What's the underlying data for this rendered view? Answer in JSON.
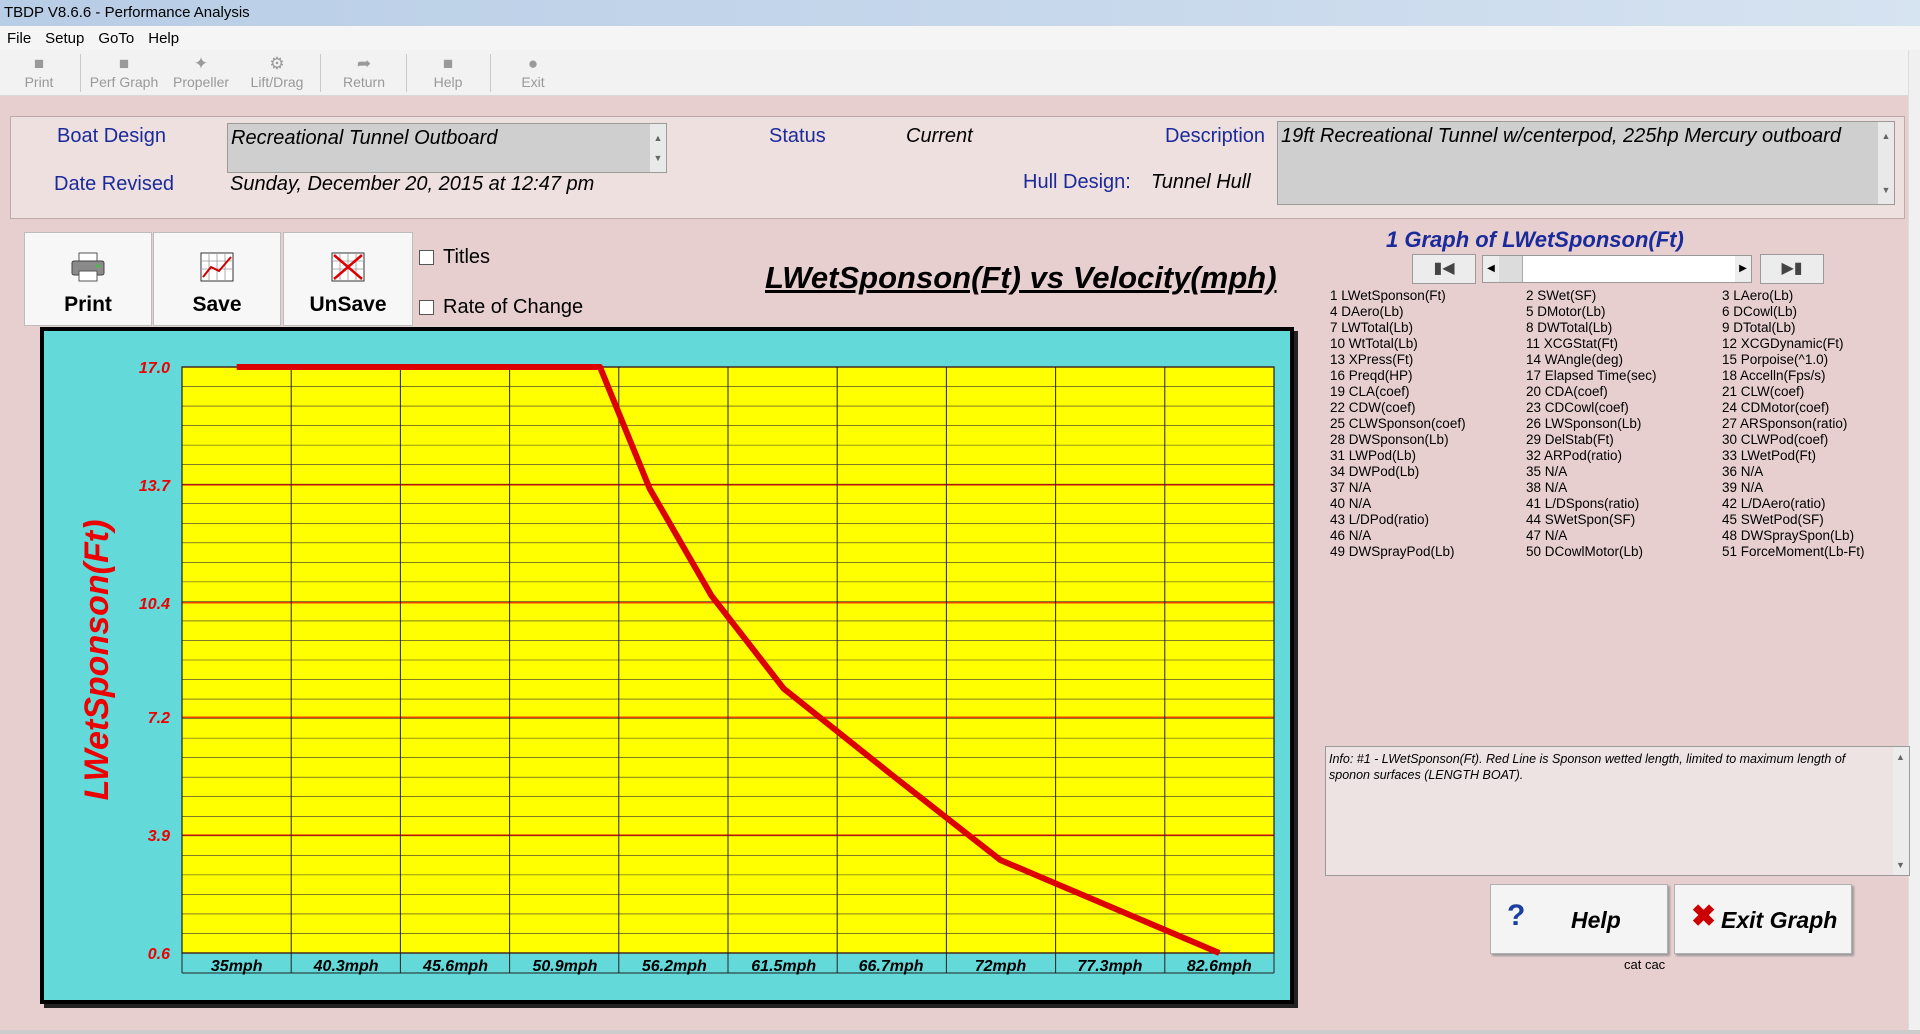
{
  "window": {
    "title": "TBDP V8.6.6 - Performance Analysis"
  },
  "menu": [
    "File",
    "Setup",
    "GoTo",
    "Help"
  ],
  "toolbar": [
    {
      "label": "Print",
      "icon": "floppy-icon"
    },
    {
      "label": "Perf Graph",
      "icon": "graph-icon"
    },
    {
      "label": "Propeller",
      "icon": "propeller-icon"
    },
    {
      "label": "Lift/Drag",
      "icon": "gear-icon"
    },
    {
      "label": "Return",
      "icon": "return-arrow-icon"
    },
    {
      "label": "Help",
      "icon": "help-icon"
    },
    {
      "label": "Exit",
      "icon": "exit-icon"
    }
  ],
  "header": {
    "boat_design_label": "Boat Design",
    "boat_design_value": "Recreational Tunnel Outboard",
    "date_revised_label": "Date Revised",
    "date_revised_value": "Sunday, December 20, 2015 at 12:47 pm",
    "status_label": "Status",
    "status_value": "Current",
    "hull_design_label": "Hull Design:",
    "hull_design_value": "Tunnel Hull",
    "description_label": "Description",
    "description_value": "19ft Recreational Tunnel w/centerpod, 225hp Mercury outboard"
  },
  "buttons": {
    "print": "Print",
    "save": "Save",
    "unsave": "UnSave"
  },
  "checkboxes": {
    "titles": "Titles",
    "rate_of_change": "Rate of Change"
  },
  "chart_title": "LWetSponson(Ft) vs Velocity(mph)",
  "chart_data": {
    "type": "line",
    "title": "LWetSponson(Ft) vs Velocity(mph)",
    "ylabel": "LWetSponson(Ft)",
    "xlabel": "",
    "x": [
      35,
      40.3,
      45.6,
      50.9,
      56.2,
      61.5,
      66.7,
      72,
      77.3,
      82.6
    ],
    "x_tick_labels": [
      "35mph",
      "40.3mph",
      "45.6mph",
      "50.9mph",
      "56.2mph",
      "61.5mph",
      "66.7mph",
      "72mph",
      "77.3mph",
      "82.6mph"
    ],
    "y_tick_labels": [
      "17.0",
      "13.7",
      "10.4",
      "7.2",
      "3.9",
      "0.6"
    ],
    "y_ticks": [
      17.0,
      13.7,
      10.4,
      7.2,
      3.9,
      0.6
    ],
    "ylim": [
      0.6,
      17.0
    ],
    "xlim": [
      32.35,
      85.25
    ],
    "series": [
      {
        "color": "#dd0000",
        "points": [
          [
            35,
            17.0
          ],
          [
            40.3,
            17.0
          ],
          [
            45.6,
            17.0
          ],
          [
            50.9,
            17.0
          ],
          [
            52.6,
            17.0
          ],
          [
            55.0,
            13.6
          ],
          [
            58.0,
            10.6
          ],
          [
            61.5,
            8.0
          ],
          [
            66.7,
            5.6
          ],
          [
            72.0,
            3.2
          ],
          [
            77.3,
            1.9
          ],
          [
            82.6,
            0.6
          ]
        ]
      }
    ],
    "grid": true,
    "plot_bg": "#ffff00",
    "frame_bg": "#63d9d9"
  },
  "graph_nav": {
    "title": "1 Graph of LWetSponson(Ft)",
    "first_icon": "first-page-icon",
    "last_icon": "last-page-icon"
  },
  "graph_list": [
    "1 LWetSponson(Ft)",
    "2 SWet(SF)",
    "3 LAero(Lb)",
    "4 DAero(Lb)",
    "5 DMotor(Lb)",
    "6 DCowl(Lb)",
    "7 LWTotal(Lb)",
    "8 DWTotal(Lb)",
    "9 DTotal(Lb)",
    "10 WtTotal(Lb)",
    "11 XCGStat(Ft)",
    "12 XCGDynamic(Ft)",
    "13 XPress(Ft)",
    "14 WAngle(deg)",
    "15 Porpoise(^1.0)",
    "16 Preqd(HP)",
    "17 Elapsed Time(sec)",
    "18 Accelln(Fps/s)",
    "19 CLA(coef)",
    "20 CDA(coef)",
    "21 CLW(coef)",
    "22 CDW(coef)",
    "23 CDCowl(coef)",
    "24 CDMotor(coef)",
    "25 CLWSponson(coef)",
    "26 LWSponson(Lb)",
    "27 ARSponson(ratio)",
    "28 DWSponson(Lb)",
    "29 DelStab(Ft)",
    "30 CLWPod(coef)",
    "31 LWPod(Lb)",
    "32 ARPod(ratio)",
    "33 LWetPod(Ft)",
    "34 DWPod(Lb)",
    "35 N/A",
    "36 N/A",
    "37 N/A",
    "38 N/A",
    "39 N/A",
    "40 N/A",
    "41 L/DSpons(ratio)",
    "42 L/DAero(ratio)",
    "43 L/DPod(ratio)",
    "44 SWetSpon(SF)",
    "45 SWetPod(SF)",
    "46 N/A",
    "47 N/A",
    "48 DWSpraySpon(Lb)",
    "49 DWSprayPod(Lb)",
    "50 DCowlMotor(Lb)",
    "51 ForceMoment(Lb-Ft)"
  ],
  "info": "Info: #1 - LWetSponson(Ft). Red Line is Sponson wetted length, limited to maximum length of sponon surfaces (LENGTH BOAT).",
  "actions": {
    "help": "Help",
    "exit": "Exit Graph"
  },
  "footer_note": "cat cac"
}
